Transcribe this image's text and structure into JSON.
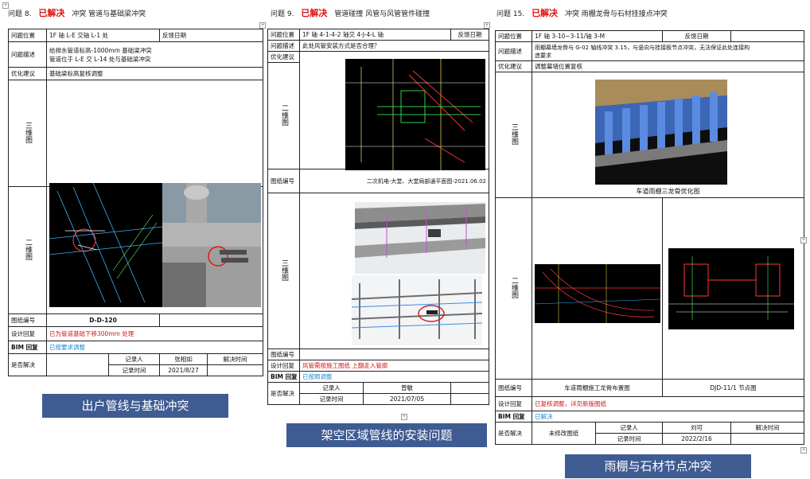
{
  "sheets": [
    {
      "id": "s1",
      "issue_no": "问题 8.",
      "status": "已解决",
      "title": "冲突 管道与基础梁冲突",
      "rows": {
        "location_label": "问题位置",
        "location_value": "1F 轴 L-E 交轴 L-1 处",
        "feedback_label": "反馈日期",
        "desc_label": "问题描述",
        "desc_line1": "给排水管道标高-1000mm 基础梁冲突",
        "desc_line2": "管道位于 L-E 交 L-14 处与基础梁冲突",
        "suggest_label": "优化建议",
        "suggest_value": "基础梁标高复核调整",
        "three_d_label": "三维图",
        "two_d_label": "二维图",
        "drawing_no_label": "图纸编号",
        "drawing_no_value": "D-D-120",
        "design_reply_label": "设计回复",
        "design_reply_value": "已为管道基础下移300mm 处理",
        "bim_reply_label": "BIM 回复",
        "bim_reply_value": "已按要求调整",
        "solved_label": "是否解决",
        "recorder_label": "记录人",
        "recorder_value": "张相如",
        "record_time_label": "记录时间",
        "record_time_value": "2021/8/27",
        "solve_time_label": "解决时间"
      },
      "caption": "出户管线与基础冲突"
    },
    {
      "id": "s2",
      "issue_no": "问题 9.",
      "status": "已解决",
      "title": "管道碰撞 风管与风管管件碰撞",
      "rows": {
        "location_label": "问题位置",
        "location_value": "1F 轴 4-1-4-2 轴交 4-J-4-L 轴",
        "feedback_label": "反馈日期",
        "desc_label": "问题描述",
        "desc_value": "此处风管安装方式是否合理？",
        "suggest_label": "优化建议",
        "two_d_label": "二维图",
        "drawing_no_label": "图纸编号",
        "drawing_no_value": "二次机电-大堂、大堂局部通平面图-2021.06.02",
        "three_d_label": "三维图",
        "drawing_no2_label": "图纸编号",
        "design_reply_label": "设计回复",
        "design_reply_value": "风管需按施工图纸 上翻走入管廊",
        "bim_reply_label": "BIM 回复",
        "bim_reply_value": "已按照调整",
        "solved_label": "是否解决",
        "recorder_label": "记录人",
        "recorder_value": "曾敏",
        "record_time_label": "记录时间",
        "record_time_value": "2021/07/05"
      },
      "caption": "架空区域管线的安装问题"
    },
    {
      "id": "s3",
      "issue_no": "问题 15.",
      "status": "已解决",
      "title": "冲突 雨棚龙骨与石材挂接点冲突",
      "rows": {
        "location_label": "问题位置",
        "location_value": "1F 轴 3-10~3-11/轴 3-M",
        "feedback_label": "反馈日期",
        "desc_label": "问题描述",
        "desc_line1": "雨棚幕墙龙骨与 G-02 轴线冲突 3.15，与竖向与挂接板节点冲突，无法保证此处连接构",
        "desc_line2": "造要求",
        "suggest_label": "优化建议",
        "suggest_value": "调整幕墙位置复核",
        "three_d_label": "三维图",
        "three_d_caption": "车道雨棚三龙骨优化图",
        "two_d_label": "二维图",
        "drawing_no_label": "图纸编号",
        "drawing_no_value": "车道雨棚施工龙骨布置图",
        "drawing_no_value2": "DJD-11/1 节点图",
        "design_reply_label": "设计回复",
        "design_reply_value": "已复核调整，详见新版图纸",
        "bim_reply_label": "BIM 回复",
        "bim_reply_value": "已解决",
        "solved_label": "是否解决",
        "solved_value": "未修改图纸",
        "recorder_label": "记录人",
        "recorder_value": "刘可",
        "record_time_label": "记录时间",
        "record_time_value": "2022/2/16",
        "solve_time_label": "解决时间"
      },
      "caption": "雨棚与石材节点冲突"
    }
  ],
  "colors": {
    "status_red": "#e01010",
    "caption_bg": "#3e5b92",
    "reply_blue": "#1a8ad0"
  },
  "icons": [
    "move-handle-icon",
    "resize-handle-icon"
  ]
}
